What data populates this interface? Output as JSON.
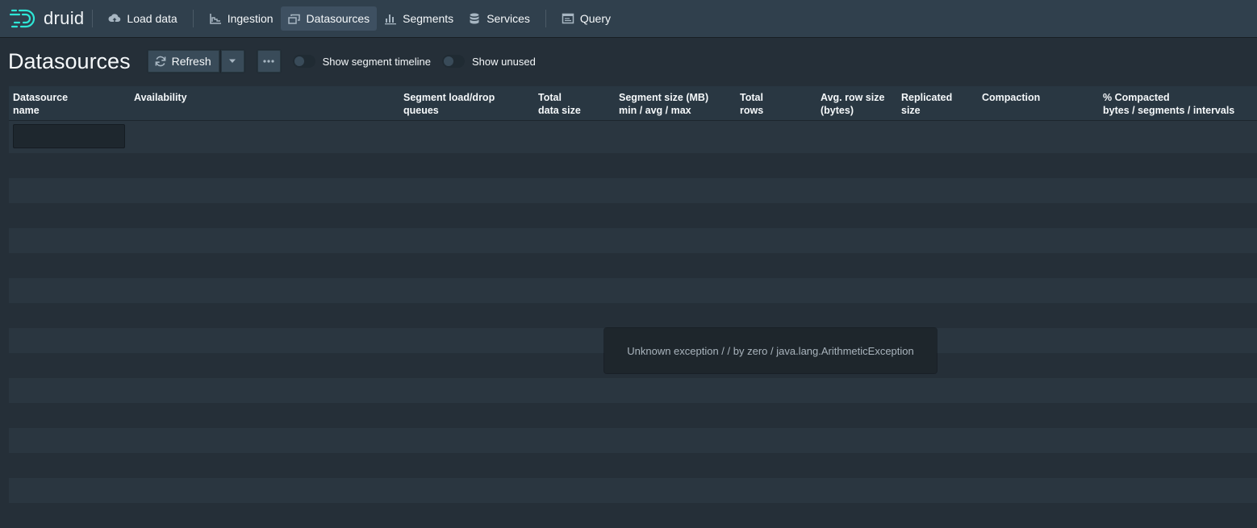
{
  "nav": {
    "logo_text": "druid",
    "items": [
      {
        "label": "Load data",
        "icon": "cloud-upload-icon"
      },
      {
        "label": "Ingestion",
        "icon": "chart-icon"
      },
      {
        "label": "Datasources",
        "icon": "multi-select-icon",
        "active": true
      },
      {
        "label": "Segments",
        "icon": "stacked-chart-icon"
      },
      {
        "label": "Services",
        "icon": "database-icon"
      },
      {
        "label": "Query",
        "icon": "application-icon"
      }
    ]
  },
  "page": {
    "title": "Datasources",
    "refresh_label": "Refresh",
    "toggles": [
      {
        "label": "Show segment timeline",
        "checked": false
      },
      {
        "label": "Show unused",
        "checked": false
      }
    ]
  },
  "table": {
    "columns": [
      {
        "line1": "Datasource",
        "line2": "name"
      },
      {
        "line1": "Availability",
        "line2": ""
      },
      {
        "line1": "Segment load/drop",
        "line2": "queues"
      },
      {
        "line1": "Total",
        "line2": "data size"
      },
      {
        "line1": "Segment size (MB)",
        "line2": "min / avg / max"
      },
      {
        "line1": "Total",
        "line2": "rows"
      },
      {
        "line1": "Avg. row size",
        "line2": "(bytes)"
      },
      {
        "line1": "Replicated",
        "line2": "size"
      },
      {
        "line1": "Compaction",
        "line2": ""
      },
      {
        "line1": "% Compacted",
        "line2": "bytes / segments / intervals"
      }
    ],
    "filter_value": "",
    "rows": []
  },
  "error": {
    "message": "Unknown exception / / by zero / java.lang.ArithmeticException"
  },
  "colors": {
    "navbar": "#30404d",
    "background": "#252f38",
    "active_tab": "#3e5061",
    "logo_accent": "#2ee6d6"
  }
}
